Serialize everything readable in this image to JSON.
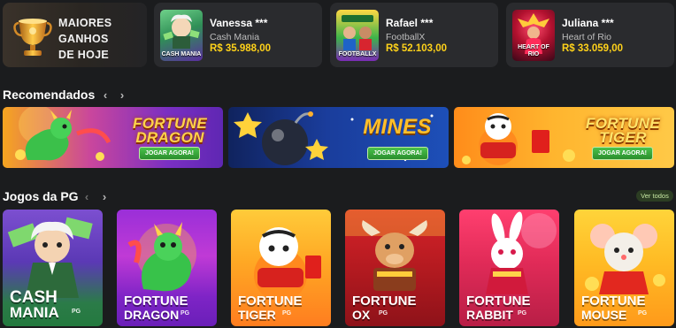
{
  "winners": {
    "title": "MAIORES GANHOS DE HOJE",
    "items": [
      {
        "name": "Vanessa ***",
        "game": "Cash Mania",
        "amount": "R$ 35.988,00",
        "thumb_label": "CASH MANIA"
      },
      {
        "name": "Rafael ***",
        "game": "FootballX",
        "amount": "R$ 52.103,00",
        "thumb_label": "FOOTBALLX"
      },
      {
        "name": "Juliana ***",
        "game": "Heart of Rio",
        "amount": "R$ 33.059,00",
        "thumb_label": "HEART OF RIO"
      }
    ]
  },
  "recommended": {
    "title": "Recomendados",
    "banners": [
      {
        "logo": "FORTUNE DRAGON",
        "cta": "JOGAR AGORA!"
      },
      {
        "logo": "MINES",
        "cta": "JOGAR AGORA!"
      },
      {
        "logo": "FORTUNE TIGER",
        "cta": "JOGAR AGORA!"
      }
    ]
  },
  "pg_games": {
    "title": "Jogos da PG",
    "see_all": "Ver todos",
    "tiles": [
      {
        "line1": "CASH",
        "line2": "MANIA",
        "badge": "PG"
      },
      {
        "line1": "FORTUNE",
        "line2": "DRAGON",
        "badge": "PG"
      },
      {
        "line1": "FORTUNE",
        "line2": "TIGER",
        "badge": "PG"
      },
      {
        "line1": "FORTUNE",
        "line2": "OX",
        "badge": "PG"
      },
      {
        "line1": "FORTUNE",
        "line2": "RABBIT",
        "badge": "PG"
      },
      {
        "line1": "FORTUNE",
        "line2": "MOUSE",
        "badge": "PG"
      }
    ]
  },
  "icons": {
    "trophy": "trophy-icon",
    "prev": "chevron-left-icon",
    "next": "chevron-right-icon"
  },
  "colors": {
    "background": "#1b1c1e",
    "card": "#2a2b2e",
    "amount": "#ffd21a",
    "cta_green": "#3aa83d"
  }
}
